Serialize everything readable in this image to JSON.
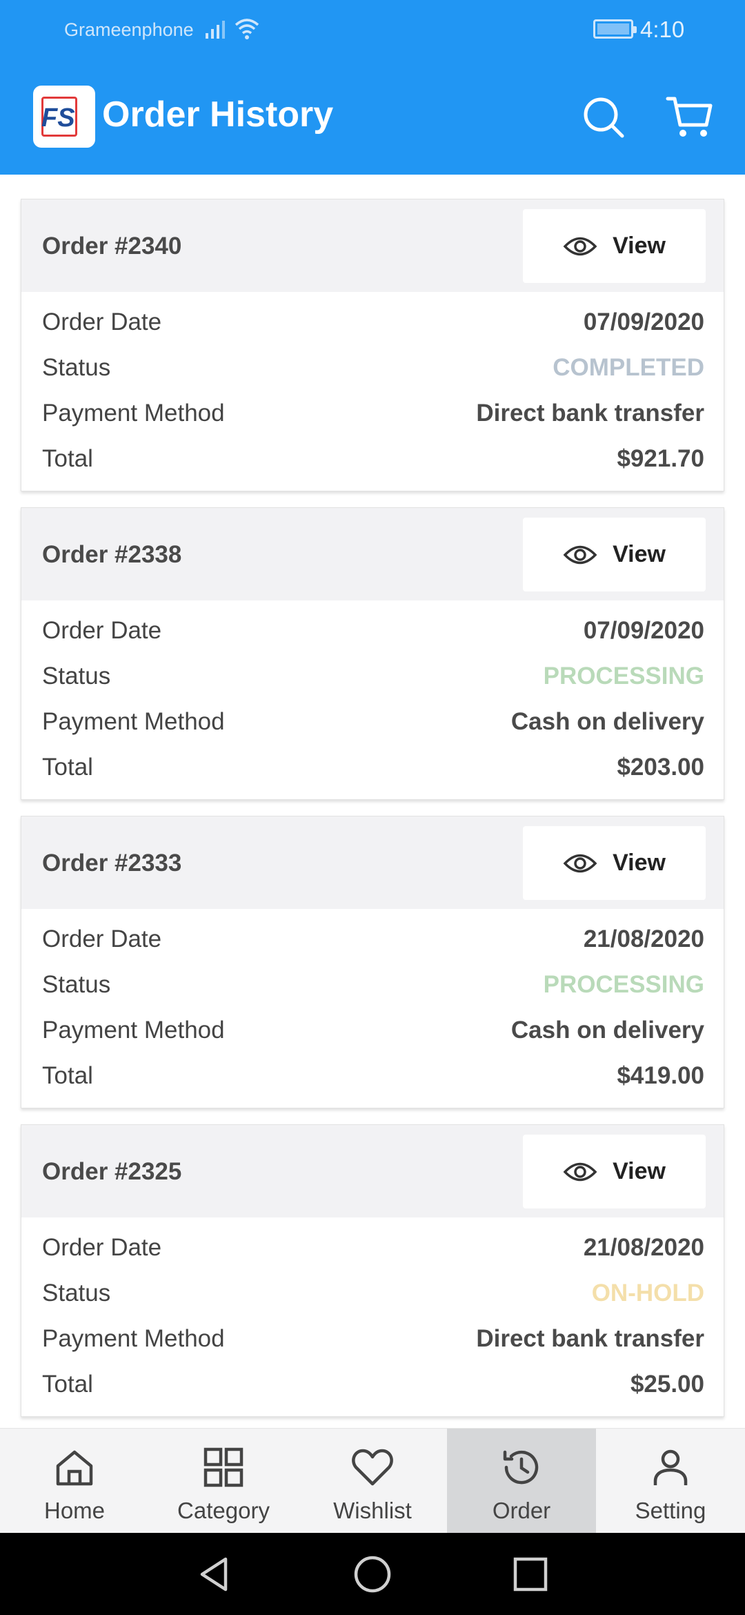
{
  "status_bar": {
    "carrier": "Grameenphone",
    "time": "4:10"
  },
  "header": {
    "title": "Order History",
    "logo_text": "FS"
  },
  "orders": [
    {
      "number": "Order #2340",
      "view_label": "View",
      "date_label": "Order Date",
      "date": "07/09/2020",
      "status_label": "Status",
      "status": "COMPLETED",
      "status_color": "#b7c3cf",
      "payment_label": "Payment Method",
      "payment": "Direct bank transfer",
      "total_label": "Total",
      "total": "$921.70"
    },
    {
      "number": "Order #2338",
      "view_label": "View",
      "date_label": "Order Date",
      "date": "07/09/2020",
      "status_label": "Status",
      "status": "PROCESSING",
      "status_color": "#b9dab9",
      "payment_label": "Payment Method",
      "payment": "Cash on delivery",
      "total_label": "Total",
      "total": "$203.00"
    },
    {
      "number": "Order #2333",
      "view_label": "View",
      "date_label": "Order Date",
      "date": "21/08/2020",
      "status_label": "Status",
      "status": "PROCESSING",
      "status_color": "#b9dab9",
      "payment_label": "Payment Method",
      "payment": "Cash on delivery",
      "total_label": "Total",
      "total": "$419.00"
    },
    {
      "number": "Order #2325",
      "view_label": "View",
      "date_label": "Order Date",
      "date": "21/08/2020",
      "status_label": "Status",
      "status": "ON-HOLD",
      "status_color": "#f4dfaa",
      "payment_label": "Payment Method",
      "payment": "Direct bank transfer",
      "total_label": "Total",
      "total": "$25.00"
    }
  ],
  "bottom_nav": [
    {
      "label": "Home",
      "icon": "home-icon",
      "active": false
    },
    {
      "label": "Category",
      "icon": "grid-icon",
      "active": false
    },
    {
      "label": "Wishlist",
      "icon": "heart-icon",
      "active": false
    },
    {
      "label": "Order",
      "icon": "history-icon",
      "active": true
    },
    {
      "label": "Setting",
      "icon": "user-icon",
      "active": false
    }
  ],
  "colors": {
    "primary": "#2196F3",
    "card_header": "#f2f2f4",
    "nav_active": "#d6d7d9"
  }
}
